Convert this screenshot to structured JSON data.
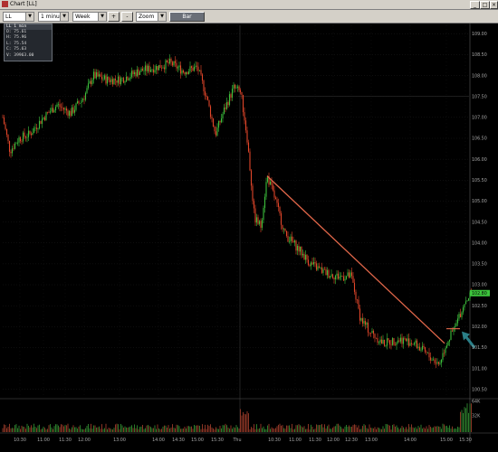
{
  "window": {
    "title": "Chart [LL]"
  },
  "toolbar": {
    "symbol": "LL",
    "interval": "1 minute",
    "range": "Week",
    "zoom_in": "+",
    "zoom_out": "-",
    "zoom": "Zoom",
    "bar": "Bar"
  },
  "ohlc": {
    "header": "LL 1 min",
    "open": "O: 75.61",
    "high": "H: 75.96",
    "low": "L: 75.54",
    "close": "C: 75.63",
    "volume": "V: 39963.00"
  },
  "price_badge": "102.80",
  "colors": {
    "up": "#3cbe3c",
    "down": "#e2462a",
    "trendline": "#e2674a",
    "arrow": "#2b7f88",
    "badge": "#3cc43c"
  },
  "chart_data": {
    "type": "candlestick",
    "ylim": [
      100.3,
      109.2
    ],
    "y_ticks": [
      "109.00",
      "108.50",
      "108.00",
      "107.50",
      "107.00",
      "106.50",
      "106.00",
      "105.50",
      "105.00",
      "104.50",
      "104.00",
      "103.50",
      "103.00",
      "102.50",
      "102.00",
      "101.50",
      "101.00",
      "100.50"
    ],
    "x_ticks": [
      "10:30",
      "11:00",
      "11:30",
      "12:00",
      "13:00",
      "14:00",
      "14:30",
      "15:00",
      "15:30",
      "Thu",
      "10:30",
      "11:00",
      "11:30",
      "12:00",
      "12:30",
      "13:00",
      "14:00",
      "15:00",
      "15:30"
    ],
    "price_path": [
      [
        0,
        107.0
      ],
      [
        8,
        106.2
      ],
      [
        18,
        106.5
      ],
      [
        30,
        106.6
      ],
      [
        45,
        107.0
      ],
      [
        60,
        107.3
      ],
      [
        75,
        107.1
      ],
      [
        90,
        107.5
      ],
      [
        100,
        108.0
      ],
      [
        115,
        107.9
      ],
      [
        130,
        107.9
      ],
      [
        150,
        108.1
      ],
      [
        170,
        108.2
      ],
      [
        185,
        108.3
      ],
      [
        200,
        108.1
      ],
      [
        215,
        108.2
      ],
      [
        225,
        107.5
      ],
      [
        235,
        106.6
      ],
      [
        245,
        107.2
      ],
      [
        255,
        107.7
      ],
      [
        263,
        107.6
      ],
      [
        270,
        106.5
      ],
      [
        278,
        104.6
      ],
      [
        285,
        104.4
      ],
      [
        292,
        105.6
      ],
      [
        300,
        105.1
      ],
      [
        312,
        104.2
      ],
      [
        325,
        103.9
      ],
      [
        340,
        103.5
      ],
      [
        355,
        103.3
      ],
      [
        370,
        103.2
      ],
      [
        385,
        103.2
      ],
      [
        395,
        102.2
      ],
      [
        405,
        101.9
      ],
      [
        420,
        101.6
      ],
      [
        440,
        101.7
      ],
      [
        455,
        101.6
      ],
      [
        470,
        101.3
      ],
      [
        482,
        101.1
      ],
      [
        490,
        101.6
      ],
      [
        500,
        102.0
      ],
      [
        510,
        102.6
      ],
      [
        518,
        102.8
      ]
    ],
    "volume_ylim": [
      0,
      64000
    ],
    "volume_ticks": [
      "64K",
      "32K"
    ],
    "annotations": [
      {
        "type": "trendline",
        "from": [
          292,
          105.6
        ],
        "to": [
          488,
          101.6
        ]
      },
      {
        "type": "horizontal_segment",
        "y": 101.95,
        "from_x": 490,
        "to_x": 505
      },
      {
        "type": "arrow",
        "points_to": [
          505,
          101.95
        ]
      }
    ]
  }
}
